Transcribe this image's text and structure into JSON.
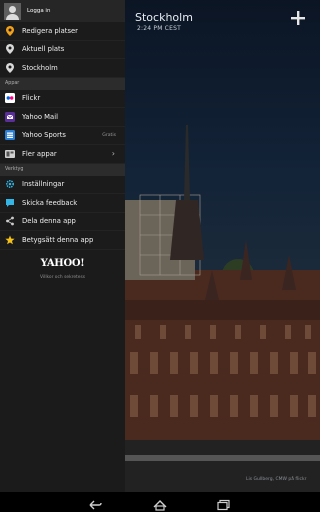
{
  "weather": {
    "city": "Stockholm",
    "time": "2:24 PM CEST",
    "photo_credit": "Lis Gullberg, CMW på flickr"
  },
  "drawer": {
    "header_label": "Logga in",
    "locations": [
      {
        "label": "Redigera platser",
        "icon": "location-pin-icon"
      },
      {
        "label": "Aktuell plats",
        "icon": "location-pin-icon"
      },
      {
        "label": "Stockholm",
        "icon": "location-pin-icon"
      }
    ],
    "apps_section": "Appar",
    "apps": [
      {
        "label": "Flickr",
        "icon": "flickr-icon",
        "extra": ""
      },
      {
        "label": "Yahoo Mail",
        "icon": "mail-icon",
        "extra": ""
      },
      {
        "label": "Yahoo Sports",
        "icon": "sports-icon",
        "extra": "Gratis"
      },
      {
        "label": "Fler appar",
        "icon": "more-apps-icon",
        "extra": ""
      }
    ],
    "tools_section": "Verktyg",
    "tools": [
      {
        "label": "Inställningar",
        "icon": "gear-icon"
      },
      {
        "label": "Skicka feedback",
        "icon": "feedback-icon"
      },
      {
        "label": "Dela denna app",
        "icon": "share-icon"
      },
      {
        "label": "Betygsätt denna app",
        "icon": "star-icon"
      }
    ],
    "brand": "YAHOO!",
    "terms": "Villkor och sekretess"
  },
  "colors": {
    "drawer_bg": "#1b1b1b",
    "accent_pin": "#f2a21a",
    "accent_cyan": "#33b5e5",
    "star": "#f6c21a"
  }
}
